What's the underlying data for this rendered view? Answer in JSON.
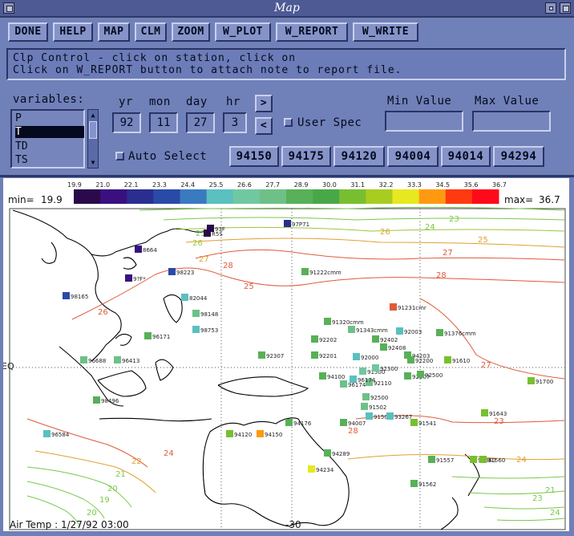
{
  "window": {
    "title": "Map"
  },
  "toolbar": {
    "buttons": [
      {
        "id": "done",
        "label": "DONE"
      },
      {
        "id": "help",
        "label": "HELP"
      },
      {
        "id": "map",
        "label": "MAP"
      },
      {
        "id": "clm",
        "label": "CLM"
      },
      {
        "id": "zoom",
        "label": "ZOOM"
      },
      {
        "id": "w_plot",
        "label": "W_PLOT"
      },
      {
        "id": "w_report",
        "label": "W_REPORT"
      },
      {
        "id": "w_write",
        "label": "W_WRITE"
      }
    ]
  },
  "message": {
    "line1": "Clp Control - click on station, click on",
    "line2": "Click on W_REPORT button to attach note to report file."
  },
  "variables": {
    "label": "variables:",
    "items": [
      "P",
      "T",
      "TD",
      "TS"
    ],
    "selected": "T"
  },
  "datetime": {
    "yr_label": "yr",
    "mon_label": "mon",
    "day_label": "day",
    "hr_label": "hr",
    "yr": "92",
    "mon": "11",
    "day": "27",
    "hr": "3"
  },
  "nav": {
    "next": ">",
    "prev": "<"
  },
  "user_spec": {
    "label": "User Spec",
    "checked": false
  },
  "min_value": {
    "label": "Min Value",
    "value": ""
  },
  "max_value": {
    "label": "Max Value",
    "value": ""
  },
  "auto_select": {
    "label": "Auto Select",
    "checked": false
  },
  "stations": [
    "94150",
    "94175",
    "94120",
    "94004",
    "94014",
    "94294"
  ],
  "colorbar": {
    "min_label": "min=",
    "min_value": "19.9",
    "max_label": "max=",
    "max_value": "36.7",
    "ticks": [
      "19.9",
      "21.0",
      "22.1",
      "23.3",
      "24.4",
      "25.5",
      "26.6",
      "27.7",
      "28.9",
      "30.0",
      "31.1",
      "32.2",
      "33.3",
      "34.5",
      "35.6",
      "36.7"
    ],
    "colors": [
      "#2a0a4a",
      "#3a1080",
      "#2a2e90",
      "#2a4aa8",
      "#3a7ac0",
      "#5ac0c0",
      "#70c8a0",
      "#6ec088",
      "#58b058",
      "#48a848",
      "#78bf30",
      "#a8cc20",
      "#e8e820",
      "#ff9a10",
      "#ff3a10",
      "#ff0a1a"
    ]
  },
  "map": {
    "footer": "Air Temp : 1/27/92 03:00",
    "lat_label": "EQ",
    "bottom_label": "-30",
    "contour_color_warm": "#e05a3a",
    "contour_color_mid": "#e0a030",
    "contour_color_cool": "#7ac84a",
    "contour_labels": [
      "23",
      "24",
      "25",
      "26",
      "27",
      "28",
      "25",
      "26",
      "27",
      "28",
      "23",
      "24",
      "24",
      "22",
      "21",
      "20",
      "19",
      "20",
      "21",
      "23",
      "24",
      "25",
      "26",
      "27",
      "28"
    ],
    "station_labels": [
      "97P71",
      "93F",
      "R5S",
      "8664",
      "9?F*",
      "98223",
      "82044",
      "98148",
      "98753",
      "96171",
      "98165",
      "96688",
      "96413",
      "98496",
      "96584",
      "91222cmm",
      "91231cmr",
      "91320cmm",
      "91343cmm",
      "92003",
      "91376cmm",
      "92000",
      "91500",
      "92110",
      "92300",
      "92307",
      "92201",
      "92202",
      "92402",
      "92408",
      "94203",
      "96174",
      "96174",
      "94100",
      "92500",
      "91502",
      "91503",
      "93267",
      "92307",
      "91541",
      "91643",
      "91610",
      "91560",
      "91560",
      "91557",
      "91562",
      "91700",
      "94007",
      "94176",
      "94120",
      "94150",
      "94289",
      "94234",
      "92200",
      "92500"
    ]
  }
}
